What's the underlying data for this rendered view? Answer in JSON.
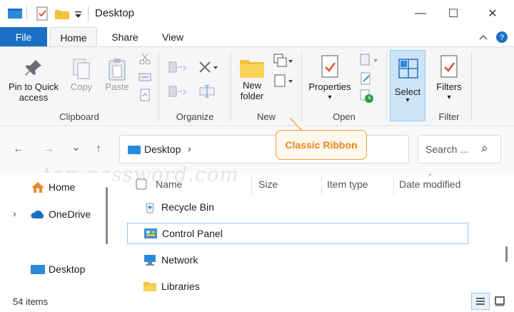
{
  "window": {
    "title": "Desktop",
    "minimize": "—",
    "maximize": "☐",
    "close": "✕"
  },
  "tabs": {
    "file": "File",
    "home": "Home",
    "share": "Share",
    "view": "View"
  },
  "ribbon": {
    "clipboard": {
      "label": "Clipboard",
      "pin_line1": "Pin to Quick",
      "pin_line2": "access",
      "copy": "Copy",
      "paste": "Paste"
    },
    "organize": {
      "label": "Organize"
    },
    "new": {
      "label": "New",
      "new_folder_line1": "New",
      "new_folder_line2": "folder"
    },
    "open": {
      "label": "Open",
      "properties": "Properties"
    },
    "select": {
      "label": "Select"
    },
    "filter": {
      "label": "Filter",
      "filters": "Filters"
    }
  },
  "nav": {
    "back": "←",
    "forward": "→",
    "recent": "⌄",
    "up": "↑",
    "address": "Desktop",
    "chevron": "›",
    "refresh": "↻",
    "search_placeholder": "Search ...",
    "search_icon": "⌕"
  },
  "callout": {
    "text": "Classic Ribbon"
  },
  "watermark": {
    "text": "top-password.com"
  },
  "sidebar": {
    "items": [
      {
        "label": "Home"
      },
      {
        "label": "OneDrive",
        "expander": "›"
      },
      {
        "label": "Desktop"
      }
    ]
  },
  "columns": {
    "name": "Name",
    "size": "Size",
    "type": "Item type",
    "date": "Date modified"
  },
  "files": [
    {
      "name": "Recycle Bin"
    },
    {
      "name": "Control Panel"
    },
    {
      "name": "Network"
    },
    {
      "name": "Libraries"
    }
  ],
  "status": {
    "count": "54 items"
  },
  "colors": {
    "file_tab": "#1a6fc4",
    "select_highlight": "#cce4f7",
    "callout_border": "#f0a040",
    "callout_text": "#e9861c",
    "folder": "#f3c23c"
  }
}
